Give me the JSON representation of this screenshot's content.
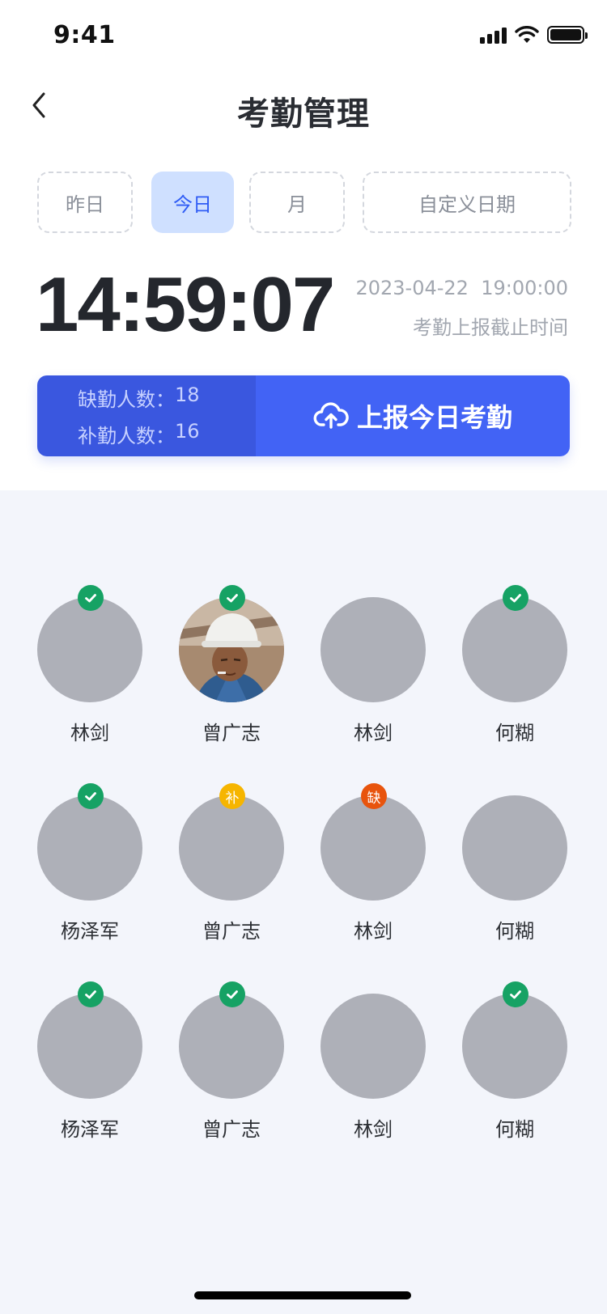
{
  "status_bar": {
    "time": "9:41"
  },
  "header": {
    "title": "考勤管理"
  },
  "tabs": [
    {
      "label": "昨日",
      "active": false
    },
    {
      "label": "今日",
      "active": true
    },
    {
      "label": "月",
      "active": false
    },
    {
      "label": "自定义日期",
      "active": false
    }
  ],
  "clock": {
    "time": "14:59:07",
    "deadline_datetime": "2023-04-22  19:00:00",
    "deadline_label": "考勤上报截止时间"
  },
  "summary": {
    "absent_label": "缺勤人数：",
    "absent_count": "18",
    "makeup_label": "补勤人数：",
    "makeup_count": "16",
    "report_button": "上报今日考勤"
  },
  "people": [
    {
      "name": "林剑",
      "status": "present",
      "badge_text": "",
      "has_photo": false
    },
    {
      "name": "曾广志",
      "status": "present",
      "badge_text": "",
      "has_photo": true
    },
    {
      "name": "林剑",
      "status": "none",
      "badge_text": "",
      "has_photo": false
    },
    {
      "name": "何糊",
      "status": "present",
      "badge_text": "",
      "has_photo": false
    },
    {
      "name": "杨泽军",
      "status": "present",
      "badge_text": "",
      "has_photo": false
    },
    {
      "name": "曾广志",
      "status": "makeup",
      "badge_text": "补",
      "has_photo": false
    },
    {
      "name": "林剑",
      "status": "absent",
      "badge_text": "缺",
      "has_photo": false
    },
    {
      "name": "何糊",
      "status": "none",
      "badge_text": "",
      "has_photo": false
    },
    {
      "name": "杨泽军",
      "status": "present",
      "badge_text": "",
      "has_photo": false
    },
    {
      "name": "曾广志",
      "status": "present",
      "badge_text": "",
      "has_photo": false
    },
    {
      "name": "林剑",
      "status": "none",
      "badge_text": "",
      "has_photo": false
    },
    {
      "name": "何糊",
      "status": "present",
      "badge_text": "",
      "has_photo": false
    }
  ],
  "colors": {
    "accent": "#4263f5",
    "accent_dark": "#3a57df",
    "tab_active_bg": "#cfe0ff",
    "present": "#16a264",
    "makeup": "#f6b500",
    "absent": "#e8540d",
    "avatar_placeholder": "#aeb0b8"
  },
  "icons": {
    "back": "chevron-left-icon",
    "upload": "cloud-upload-icon",
    "present_badge": "check-icon"
  }
}
